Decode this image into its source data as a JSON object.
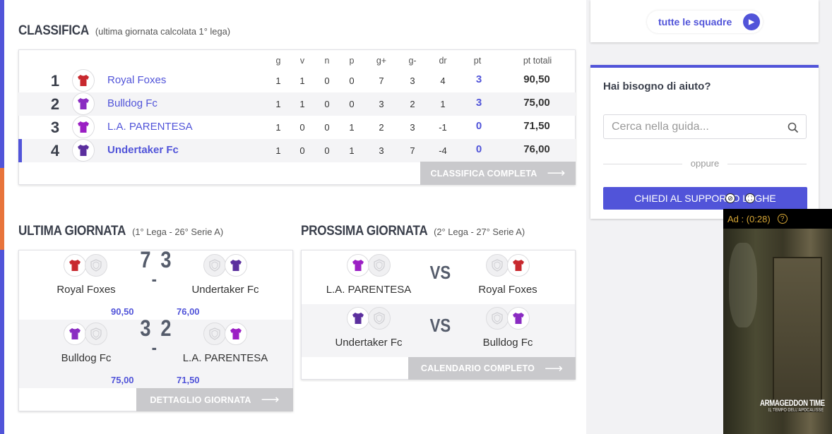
{
  "colors": {
    "accent": "#5154d9",
    "footer_tab": "#c9c9cc",
    "jersey_red": "#c8282e",
    "jersey_purple": "#7a2bbf",
    "jersey_violet": "#5b2f9e"
  },
  "standings": {
    "title": "CLASSIFICA",
    "subtitle": "(ultima giornata calcolata 1° lega)",
    "columns": [
      "g",
      "v",
      "n",
      "p",
      "g+",
      "g-",
      "dr",
      "pt",
      "pt totali"
    ],
    "rows": [
      {
        "rank": "1",
        "team": "Royal Foxes",
        "g": "1",
        "v": "1",
        "n": "0",
        "p": "0",
        "gp": "7",
        "gm": "3",
        "dr": "4",
        "pt": "3",
        "ptt": "90,50"
      },
      {
        "rank": "2",
        "team": "Bulldog Fc",
        "g": "1",
        "v": "1",
        "n": "0",
        "p": "0",
        "gp": "3",
        "gm": "2",
        "dr": "1",
        "pt": "3",
        "ptt": "75,00"
      },
      {
        "rank": "3",
        "team": "L.A. PARENTESA",
        "g": "1",
        "v": "0",
        "n": "0",
        "p": "1",
        "gp": "2",
        "gm": "3",
        "dr": "-1",
        "pt": "0",
        "ptt": "71,50"
      },
      {
        "rank": "4",
        "team": "Undertaker Fc",
        "g": "1",
        "v": "0",
        "n": "0",
        "p": "1",
        "gp": "3",
        "gm": "7",
        "dr": "-4",
        "pt": "0",
        "ptt": "76,00"
      }
    ],
    "full_link": "CLASSIFICA COMPLETA"
  },
  "last_round": {
    "title": "ULTIMA GIORNATA",
    "subtitle": "(1° Lega - 26° Serie A)",
    "matches": [
      {
        "home": "Royal Foxes",
        "away": "Undertaker Fc",
        "home_goals": "7",
        "away_goals": "3",
        "sep": "-",
        "home_pts": "90,50",
        "away_pts": "76,00"
      },
      {
        "home": "Bulldog Fc",
        "away": "L.A. PARENTESA",
        "home_goals": "3",
        "away_goals": "2",
        "sep": "-",
        "home_pts": "75,00",
        "away_pts": "71,50"
      }
    ],
    "detail_link": "DETTAGLIO GIORNATA"
  },
  "next_round": {
    "title": "PROSSIMA GIORNATA",
    "subtitle": "(2° Lega - 27° Serie A)",
    "matches": [
      {
        "home": "L.A. PARENTESA",
        "away": "Royal Foxes",
        "vs": "VS"
      },
      {
        "home": "Undertaker Fc",
        "away": "Bulldog Fc",
        "vs": "VS"
      }
    ],
    "calendar_link": "CALENDARIO COMPLETO"
  },
  "sidebar": {
    "all_teams": "tutte le squadre",
    "help_title": "Hai bisogno di aiuto?",
    "search_placeholder": "Cerca nella guida...",
    "or_text": "oppure",
    "support_button": "CHIEDI AL SUPPORTO LEGHE"
  },
  "ad": {
    "label": "Ad : (0:28)",
    "help": "?",
    "title": "ARMAGEDDON TIME",
    "subtitle": "IL TEMPO DELL'APOCALISSE"
  },
  "icons": [
    "arrow-right-icon",
    "play-circle-icon",
    "search-icon",
    "shield-placeholder-icon",
    "jersey-icon",
    "help-circle-icon",
    "mute-icon",
    "fullscreen-icon"
  ]
}
